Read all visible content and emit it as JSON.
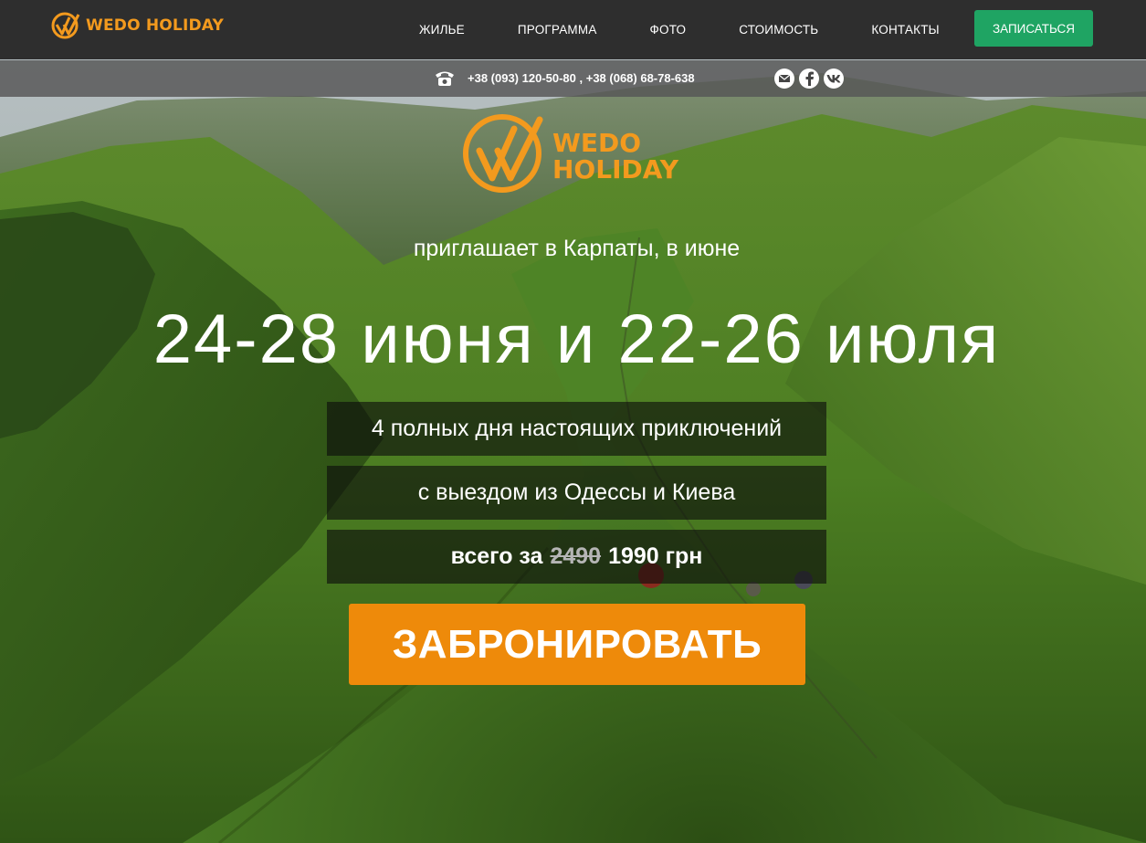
{
  "brand": {
    "name": "WEDO HOLIDAY",
    "logo_icon": "checkmark-w-circle-icon",
    "accent_color": "#f39a1e"
  },
  "nav": {
    "items": [
      {
        "label": "ЖИЛЬЕ"
      },
      {
        "label": "ПРОГРАММА"
      },
      {
        "label": "ФОТО"
      },
      {
        "label": "СТОИМОСТЬ"
      },
      {
        "label": "КОНТАКТЫ"
      }
    ],
    "signup_label": "ЗАПИСАТЬСЯ",
    "signup_color": "#1fa463"
  },
  "contact": {
    "phones": "+38 (093) 120-50-80 , +38 (068) 68-78-638",
    "phone_icon": "telephone-icon",
    "socials": [
      {
        "icon": "email-icon"
      },
      {
        "icon": "facebook-icon"
      },
      {
        "icon": "vk-icon"
      }
    ]
  },
  "hero": {
    "logo_line1": "WEDO",
    "logo_line2": "HOLIDAY",
    "tagline": "приглашает в Карпаты, в июне",
    "dates": "24-28 июня и 22-26 июля",
    "info": [
      "4 полных дня настоящих приключений",
      "с выездом из Одессы и Киева"
    ],
    "price_prefix": "всего за",
    "old_price": "2490",
    "new_price": "1990 грн",
    "book_label": "ЗАБРОНИРОВАТЬ",
    "book_color": "#ee8a0a"
  }
}
